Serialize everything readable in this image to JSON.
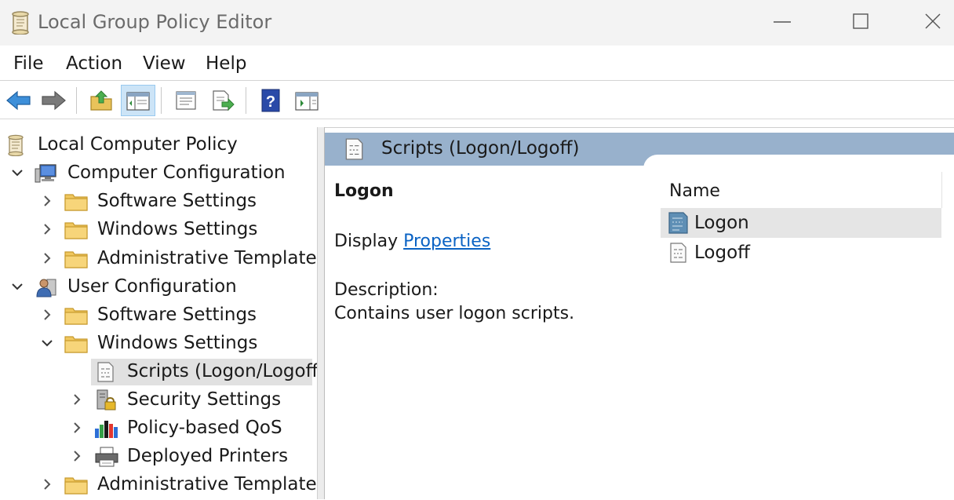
{
  "window": {
    "title": "Local Group Policy Editor"
  },
  "menu": [
    "File",
    "Action",
    "View",
    "Help"
  ],
  "toolbar": {
    "buttons": [
      {
        "name": "back-button",
        "icon": "arrow-left-icon"
      },
      {
        "name": "forward-button",
        "icon": "arrow-right-icon"
      },
      {
        "name": "up-one-level-button",
        "icon": "folder-up-icon"
      },
      {
        "name": "show-hide-console-tree-button",
        "icon": "console-tree-icon"
      },
      {
        "name": "properties-button",
        "icon": "properties-icon"
      },
      {
        "name": "export-list-button",
        "icon": "export-list-icon"
      },
      {
        "name": "help-button",
        "icon": "help-icon"
      },
      {
        "name": "show-action-pane-button",
        "icon": "action-pane-icon"
      }
    ]
  },
  "tree": {
    "nodes": [
      {
        "label": "Local Computer Policy",
        "icon": "policy-scroll-icon",
        "chevron": "none"
      },
      {
        "label": "Computer Configuration",
        "icon": "computer-icon",
        "chevron": "expanded"
      },
      {
        "label": "Software Settings",
        "icon": "folder-icon",
        "chevron": "collapsed"
      },
      {
        "label": "Windows Settings",
        "icon": "folder-icon",
        "chevron": "collapsed"
      },
      {
        "label": "Administrative Templates",
        "icon": "folder-icon",
        "chevron": "collapsed"
      },
      {
        "label": "User Configuration",
        "icon": "user-icon",
        "chevron": "expanded"
      },
      {
        "label": "Software Settings",
        "icon": "folder-icon",
        "chevron": "collapsed"
      },
      {
        "label": "Windows Settings",
        "icon": "folder-icon",
        "chevron": "expanded"
      },
      {
        "label": "Scripts (Logon/Logoff)",
        "icon": "script-icon",
        "chevron": "none",
        "selected": true
      },
      {
        "label": "Security Settings",
        "icon": "security-icon",
        "chevron": "collapsed"
      },
      {
        "label": "Policy-based QoS",
        "icon": "qos-chart-icon",
        "chevron": "collapsed"
      },
      {
        "label": "Deployed Printers",
        "icon": "printer-icon",
        "chevron": "collapsed"
      },
      {
        "label": "Administrative Templates",
        "icon": "folder-icon",
        "chevron": "collapsed"
      }
    ]
  },
  "details": {
    "header_title": "Scripts (Logon/Logoff)",
    "extended": {
      "item_title": "Logon",
      "display_prefix": "Display",
      "display_link": "Properties",
      "description_label": "Description:",
      "description": "Contains user logon scripts."
    },
    "list": {
      "column": "Name",
      "rows": [
        {
          "label": "Logon",
          "icon": "logon-script-icon",
          "highlighted": true
        },
        {
          "label": "Logoff",
          "icon": "logoff-script-icon",
          "highlighted": false
        }
      ]
    }
  },
  "colors": {
    "header_band": "#98b1cc",
    "link": "#0b63c4",
    "selection": "#e1e1e1",
    "toolbar_pressed": "#cce4f7"
  }
}
